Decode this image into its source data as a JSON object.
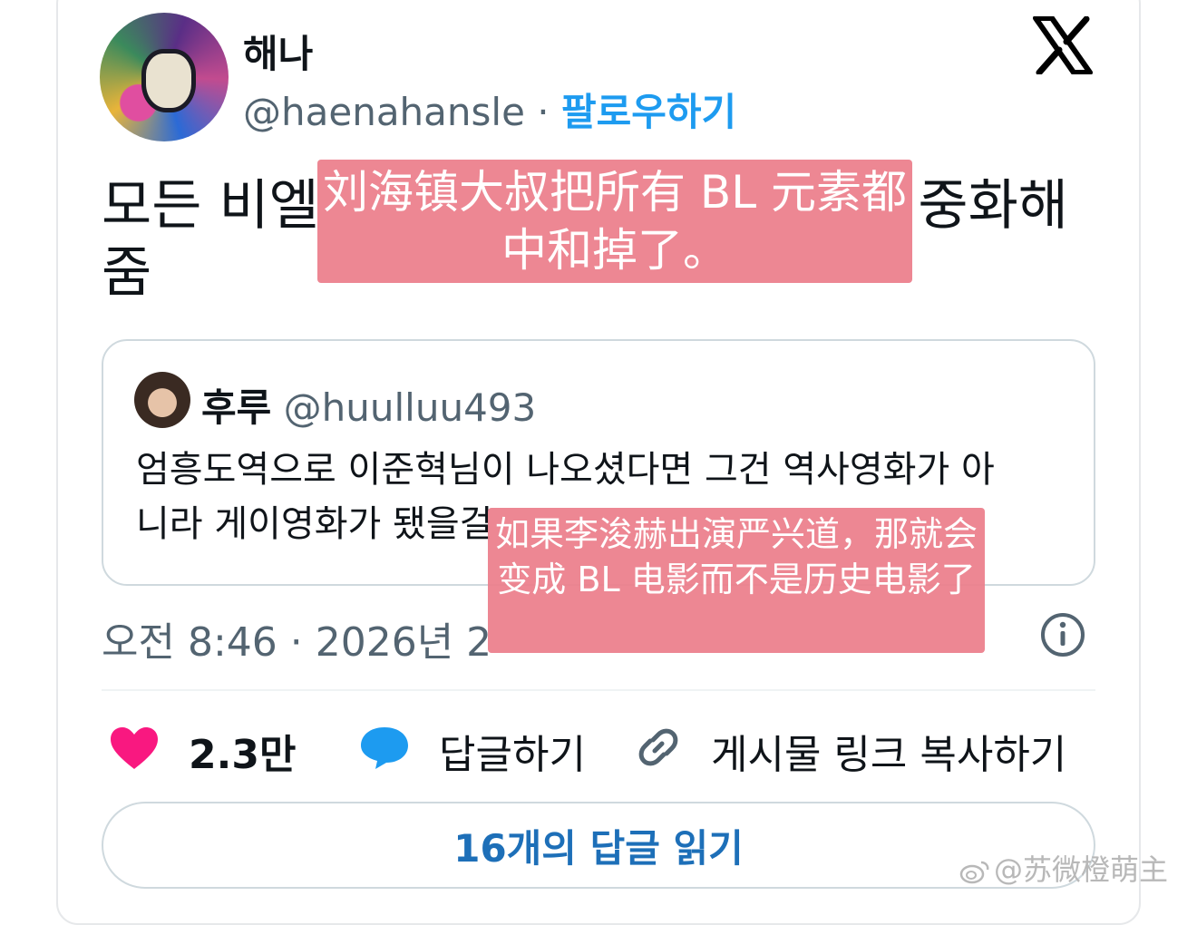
{
  "author": {
    "display_name": "해나",
    "handle": "@haenahansle",
    "separator": "·",
    "follow_label": "팔로우하기"
  },
  "tweet": {
    "text_visible": "모든 비엘적 요소를 아저씨가 다 중화해 줌",
    "line1_left": "모든 비엘",
    "line1_right": "중화해",
    "line2": "줌"
  },
  "quote": {
    "name": "후루",
    "handle": "@huulluu493",
    "text_line1": "엄흥도역으로 이준혁님이 나오셨다면 그건 역사영화가 아",
    "text_line2": "니라 게이영화가 됐을걸"
  },
  "meta": {
    "timestamp": "오전 8:46 · 2026년 2"
  },
  "actions": {
    "like_count": "2.3만",
    "reply_label": "답글하기",
    "copy_link_label": "게시물 링크 복사하기",
    "read_replies_label": "16개의 답글 읽기"
  },
  "overlays": {
    "translation_1": "刘海镇大叔把所有 BL 元素都中和掉了。",
    "translation_2": "如果李浚赫出演严兴道，那就会变成 BL 电影而不是历史电影了"
  },
  "watermark": "@苏微橙萌主",
  "icons": [
    "x-logo-icon",
    "info-icon",
    "heart-icon",
    "reply-icon",
    "link-icon",
    "weibo-icon"
  ],
  "colors": {
    "accent": "#1d9bf0",
    "heart": "#f91880",
    "reply": "#1d9bf0",
    "overlay": "#ec808c",
    "muted_text": "#536471"
  }
}
